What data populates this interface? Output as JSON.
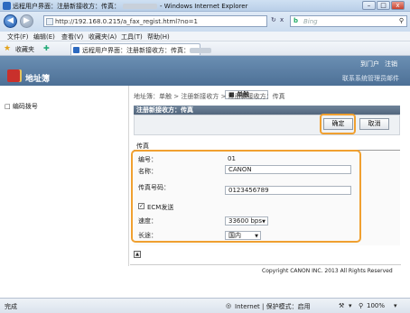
{
  "window": {
    "title_prefix": "远程用户界面：注册新接收方：传真：",
    "title_suffix": "- Windows Internet Explorer",
    "controls": [
      "–",
      "□",
      "x"
    ]
  },
  "address": {
    "url": "http://192.168.0.215/a_fax_regist.html?no=1",
    "search_placeholder": "Bing",
    "refresh": "↻",
    "stop": "x"
  },
  "menu": [
    "文件(F)",
    "编辑(E)",
    "查看(V)",
    "收藏夹(A)",
    "工具(T)",
    "帮助(H)"
  ],
  "favorites": {
    "label": "收藏夹",
    "tab_title": "远程用户界面：注册新接收方：传真："
  },
  "header": {
    "title": "地址簿",
    "top_links": [
      "到门户",
      "注销"
    ],
    "sublink": "联系系统管理员邮件"
  },
  "sidebar": {
    "items": [
      {
        "label": "单触"
      },
      {
        "label": "编码拨号"
      }
    ]
  },
  "breadcrumb": "地址簿：单触 > 注册新接收方 > 注册新接收方：传真",
  "panel": {
    "title": "注册新接收方：传真",
    "ok_label": "确定",
    "cancel_label": "取消"
  },
  "form": {
    "section_title": "传真",
    "number_label": "编号：",
    "number_value": "01",
    "name_label": "名称：",
    "name_value": "CANON",
    "fax_label": "传真号码：",
    "fax_value": "0123456789",
    "ecm_checked": true,
    "ecm_label": "ECM发送",
    "speed_label": "速度：",
    "speed_value": "33600 bps",
    "long_label": "长途：",
    "long_value": "国内"
  },
  "to_top": "▲",
  "footer": {
    "copyright": "Copyright CANON INC. 2013 All Rights Reserved"
  },
  "status": {
    "left": "完成",
    "zone": "Internet | 保护模式：启用",
    "zoom": "100%"
  },
  "colors": {
    "accent": "#f0a030",
    "header": "#5a7ea3"
  }
}
